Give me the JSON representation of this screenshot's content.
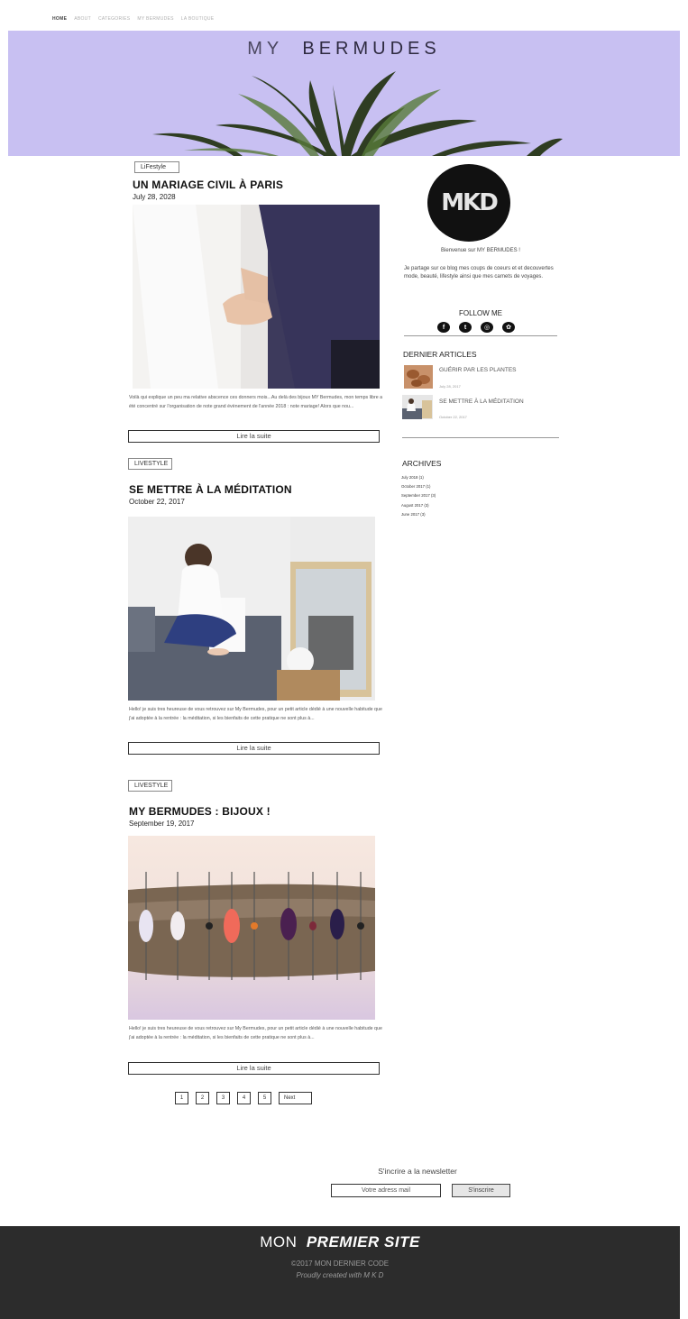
{
  "nav": {
    "items": [
      "HOME",
      "ABOUT",
      "CATEGORIES",
      "MY BERMUDES",
      "LA BOUTIQUE"
    ]
  },
  "hero": {
    "title_light": "MY",
    "title_bold": "BERMUDES",
    "background_color": "#c8c0f2"
  },
  "posts": [
    {
      "tag": "LiFestyle",
      "title": "UN  MARIAGE CIVIL À PARIS",
      "date": "July 28, 2028",
      "excerpt": "Voilà qui explique un peu ma relative abscence ces donners mois...Au delà des bijoux MY Bermudes, mon temps libre a été concentré sur l'organisation de note grand évènement de l'année 2018 : note mariage! Alors que nou...",
      "more": "Lire la suite"
    },
    {
      "tag": "LIVESTYLE",
      "title": "SE METTRE À LA MÉDITATION",
      "date": "October 22, 2017",
      "excerpt": "Hello! je suis tres heureuse de vous retrouvez sur My Bermudes, pour un petit article dédié à une nouvelle habitude que j'ai adoptée à la rentrée : la méditation, si les bienfaits de cette pratique ne sont plus à...",
      "more": "Lire la suite"
    },
    {
      "tag": "LIVESTYLE",
      "title": "MY BERMUDES : BIJOUX !",
      "date": "September 19, 2017",
      "excerpt": "Hello! je suis tres heureuse de vous retrouvez sur My Bermudes, pour un petit article dédié à une nouvelle habitude que j'ai adoptée à la rentrée : la méditation, si les bienfaits de cette pratique ne sont plus à...",
      "more": "Lire la suite"
    }
  ],
  "sidebar": {
    "avatar_text": "MKD",
    "welcome": "Bienvenue sur MY BERMUDES !",
    "intro": "Je partage sur ce blog mes coups de coeurs et et decouvertes mode, beauté, lifestyle ainsi que mes carnets de voyages.",
    "follow": "FOLLOW ME",
    "social_icons": [
      "facebook-icon",
      "twitter-icon",
      "instagram-icon",
      "sharethis-icon"
    ],
    "recent_heading": "DERNIER ARTICLES",
    "recent": [
      {
        "title": "GUÉRIR PAR LES PLANTES",
        "date": "July 28, 2017"
      },
      {
        "title": "SE METTRE À LA MÉDITATION",
        "date": "October 22, 2017"
      }
    ],
    "archives_heading": "ARCHIVES",
    "archives": [
      "July 2018 (1)",
      "October 2017 (1)",
      "September 2017 (3)",
      "August 2017 (3)",
      "June 2017 (3)"
    ]
  },
  "pagination": [
    "1",
    "2",
    "3",
    "4",
    "5",
    "Next"
  ],
  "newsletter": {
    "label": "S'incrire a la newsletter",
    "placeholder": "Votre adress mail",
    "button": "S'inscrire"
  },
  "footer": {
    "title_light": "MON",
    "title_bold": "PREMIER SITE",
    "copyright": "©2017 MON DERNIER CODE",
    "credit": "Proudly created with M K D",
    "background_color": "#2c2c2c"
  }
}
